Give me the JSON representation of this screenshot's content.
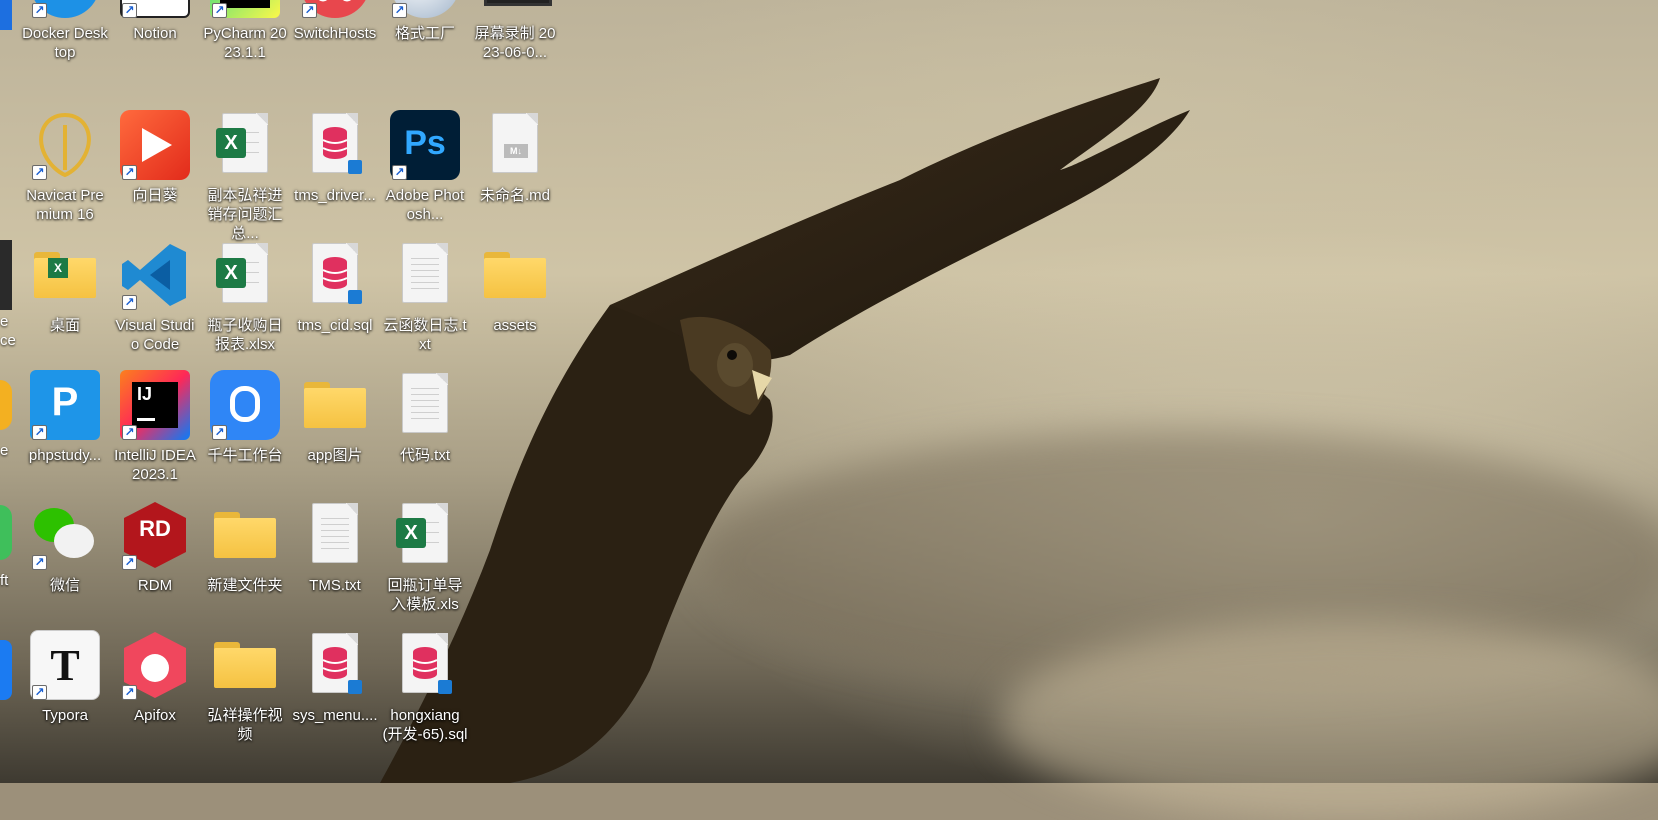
{
  "desktop": {
    "icons": [
      {
        "id": "docker",
        "label": "Docker Desktop",
        "icon": "docker-whale-icon",
        "col": 0,
        "row": 0,
        "shortcut": true
      },
      {
        "id": "notion",
        "label": "Notion",
        "icon": "notion-icon",
        "col": 1,
        "row": 0,
        "shortcut": true
      },
      {
        "id": "pycharm",
        "label": "PyCharm 2023.1.1",
        "icon": "pycharm-icon",
        "col": 2,
        "row": 0,
        "shortcut": true
      },
      {
        "id": "switchhosts",
        "label": "SwitchHosts",
        "icon": "switchhosts-icon",
        "col": 3,
        "row": 0,
        "shortcut": true
      },
      {
        "id": "format-factory",
        "label": "格式工厂",
        "icon": "format-factory-icon",
        "col": 4,
        "row": 0,
        "shortcut": true
      },
      {
        "id": "screen-recording",
        "label": "屏幕录制 2023-06-0...",
        "icon": "video-file-icon",
        "col": 5,
        "row": 0,
        "shortcut": false
      },
      {
        "id": "navicat",
        "label": "Navicat Premium 16",
        "icon": "navicat-icon",
        "col": 0,
        "row": 1,
        "shortcut": true
      },
      {
        "id": "sunlogin",
        "label": "向日葵",
        "icon": "sunlogin-icon",
        "col": 1,
        "row": 1,
        "shortcut": true
      },
      {
        "id": "excel-copy",
        "label": "副本弘祥进销存问题汇总...",
        "icon": "excel-file-icon",
        "col": 2,
        "row": 1,
        "shortcut": false
      },
      {
        "id": "tms-driver",
        "label": "tms_driver...",
        "icon": "sql-file-icon",
        "col": 3,
        "row": 1,
        "shortcut": false
      },
      {
        "id": "photoshop",
        "label": "Adobe Photosh...",
        "icon": "photoshop-icon",
        "col": 4,
        "row": 1,
        "shortcut": true
      },
      {
        "id": "untitled-md",
        "label": "未命名.md",
        "icon": "markdown-file-icon",
        "col": 5,
        "row": 1,
        "shortcut": false
      },
      {
        "id": "desktop-folder",
        "label": "桌面",
        "icon": "folder-excel-icon",
        "col": 0,
        "row": 2,
        "shortcut": false
      },
      {
        "id": "vscode",
        "label": "Visual Studio Code",
        "icon": "vscode-icon",
        "col": 1,
        "row": 2,
        "shortcut": true
      },
      {
        "id": "bottle-report",
        "label": "瓶子收购日报表.xlsx",
        "icon": "excel-file-icon",
        "col": 2,
        "row": 2,
        "shortcut": false
      },
      {
        "id": "tms-cid",
        "label": "tms_cid.sql",
        "icon": "sql-file-icon",
        "col": 3,
        "row": 2,
        "shortcut": false
      },
      {
        "id": "cloud-log",
        "label": "云函数日志.txt",
        "icon": "text-file-icon",
        "col": 4,
        "row": 2,
        "shortcut": false
      },
      {
        "id": "assets",
        "label": "assets",
        "icon": "folder-icon",
        "col": 5,
        "row": 2,
        "shortcut": false
      },
      {
        "id": "phpstudy",
        "label": "phpstudy...",
        "icon": "phpstudy-icon",
        "col": 0,
        "row": 3,
        "shortcut": true
      },
      {
        "id": "idea",
        "label": "IntelliJ IDEA 2023.1",
        "icon": "intellij-idea-icon",
        "col": 1,
        "row": 3,
        "shortcut": true
      },
      {
        "id": "qianniu",
        "label": "千牛工作台",
        "icon": "qianniu-icon",
        "col": 2,
        "row": 3,
        "shortcut": true
      },
      {
        "id": "app-images",
        "label": "app图片",
        "icon": "folder-icon",
        "col": 3,
        "row": 3,
        "shortcut": false
      },
      {
        "id": "code-txt",
        "label": "代码.txt",
        "icon": "text-file-icon",
        "col": 4,
        "row": 3,
        "shortcut": false
      },
      {
        "id": "wechat",
        "label": "微信",
        "icon": "wechat-icon",
        "col": 0,
        "row": 4,
        "shortcut": true
      },
      {
        "id": "rdm",
        "label": "RDM",
        "icon": "rdm-icon",
        "col": 1,
        "row": 4,
        "shortcut": true
      },
      {
        "id": "new-folder",
        "label": "新建文件夹",
        "icon": "folder-icon",
        "col": 2,
        "row": 4,
        "shortcut": false
      },
      {
        "id": "tms-txt",
        "label": "TMS.txt",
        "icon": "text-file-icon",
        "col": 3,
        "row": 4,
        "shortcut": false
      },
      {
        "id": "return-order",
        "label": "回瓶订单导入模板.xls",
        "icon": "excel-file-icon",
        "col": 4,
        "row": 4,
        "shortcut": false
      },
      {
        "id": "typora",
        "label": "Typora",
        "icon": "typora-icon",
        "col": 0,
        "row": 5,
        "shortcut": true
      },
      {
        "id": "apifox",
        "label": "Apifox",
        "icon": "apifox-icon",
        "col": 1,
        "row": 5,
        "shortcut": true
      },
      {
        "id": "operation-video",
        "label": "弘祥操作视频",
        "icon": "folder-icon",
        "col": 2,
        "row": 5,
        "shortcut": false
      },
      {
        "id": "sys-menu",
        "label": "sys_menu....",
        "icon": "sql-file-icon",
        "col": 3,
        "row": 5,
        "shortcut": false
      },
      {
        "id": "hongxiang-sql",
        "label": "hongxiang(开发-65).sql",
        "icon": "sql-file-icon",
        "col": 4,
        "row": 5,
        "shortcut": false
      }
    ],
    "edge_labels": {
      "row2": "e\nce",
      "row3": "e",
      "row4": "ft"
    }
  }
}
